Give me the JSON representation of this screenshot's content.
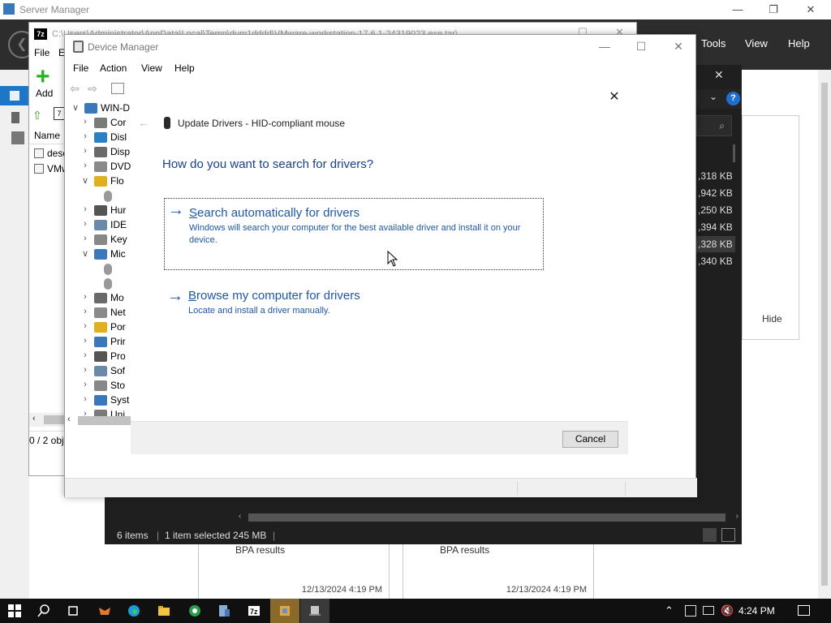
{
  "server_manager": {
    "title": "Server Manager",
    "window_controls": [
      "—",
      "❐",
      "✕"
    ],
    "menu": [
      "Tools",
      "View",
      "Help"
    ],
    "right_panel_button": "Hide",
    "bpa_tiles": [
      {
        "label": "BPA results",
        "timestamp": "12/13/2024 4:19 PM"
      },
      {
        "label": "BPA results",
        "timestamp": "12/13/2024 4:19 PM"
      }
    ]
  },
  "explorer_dark": {
    "sizes": [
      ",318 KB",
      ",942 KB",
      ",250 KB",
      ",394 KB",
      ",328 KB",
      ",340 KB"
    ],
    "selected_index": 4,
    "status": {
      "items": "6 items",
      "selection": "1 item selected  245 MB"
    }
  },
  "sevenzip": {
    "app_badge": "7z",
    "path": "C:\\Users\\Administrator\\AppData\\Local\\Temp\\dum1dddd\\VMware-workstation-17.6.1-24319023.exe.tar\\",
    "menu": [
      "File",
      "E"
    ],
    "add_label": "Add",
    "column_name": "Name",
    "rows": [
      "desc",
      "VMw"
    ],
    "status": "0 / 2 obj"
  },
  "device_manager": {
    "title": "Device Manager",
    "menu": [
      "File",
      "Action",
      "View",
      "Help"
    ],
    "tree": [
      {
        "exp": "∨",
        "label": "WIN-D",
        "level": 0
      },
      {
        "exp": "›",
        "label": "Cor",
        "level": 1
      },
      {
        "exp": "›",
        "label": "Disl",
        "level": 1
      },
      {
        "exp": "›",
        "label": "Disp",
        "level": 1
      },
      {
        "exp": "›",
        "label": "DVD",
        "level": 1
      },
      {
        "exp": "∨",
        "label": "Flo",
        "level": 1
      },
      {
        "exp": "",
        "label": "",
        "level": 2
      },
      {
        "exp": "›",
        "label": "Hur",
        "level": 1
      },
      {
        "exp": "›",
        "label": "IDE",
        "level": 1
      },
      {
        "exp": "›",
        "label": "Key",
        "level": 1
      },
      {
        "exp": "∨",
        "label": "Mic",
        "level": 1
      },
      {
        "exp": "",
        "label": "",
        "level": 2
      },
      {
        "exp": "",
        "label": "",
        "level": 2
      },
      {
        "exp": "›",
        "label": "Mo",
        "level": 1
      },
      {
        "exp": "›",
        "label": "Net",
        "level": 1
      },
      {
        "exp": "›",
        "label": "Por",
        "level": 1
      },
      {
        "exp": "›",
        "label": "Prir",
        "level": 1
      },
      {
        "exp": "›",
        "label": "Pro",
        "level": 1
      },
      {
        "exp": "›",
        "label": "Sof",
        "level": 1
      },
      {
        "exp": "›",
        "label": "Sto",
        "level": 1
      },
      {
        "exp": "›",
        "label": "Syst",
        "level": 1
      },
      {
        "exp": "›",
        "label": "Uni",
        "level": 1
      }
    ]
  },
  "update_drivers": {
    "title": "Update Drivers - HID-compliant mouse",
    "heading": "How do you want to search for drivers?",
    "option_auto": {
      "first_letter": "S",
      "rest": "earch automatically for drivers",
      "description": "Windows will search your computer for the best available driver and install it on your device."
    },
    "option_browse": {
      "first_letter": "B",
      "rest": "rowse my computer for drivers",
      "description": "Locate and install a driver manually."
    },
    "cancel_label": "Cancel"
  },
  "taskbar": {
    "clock": "4:24 PM"
  }
}
